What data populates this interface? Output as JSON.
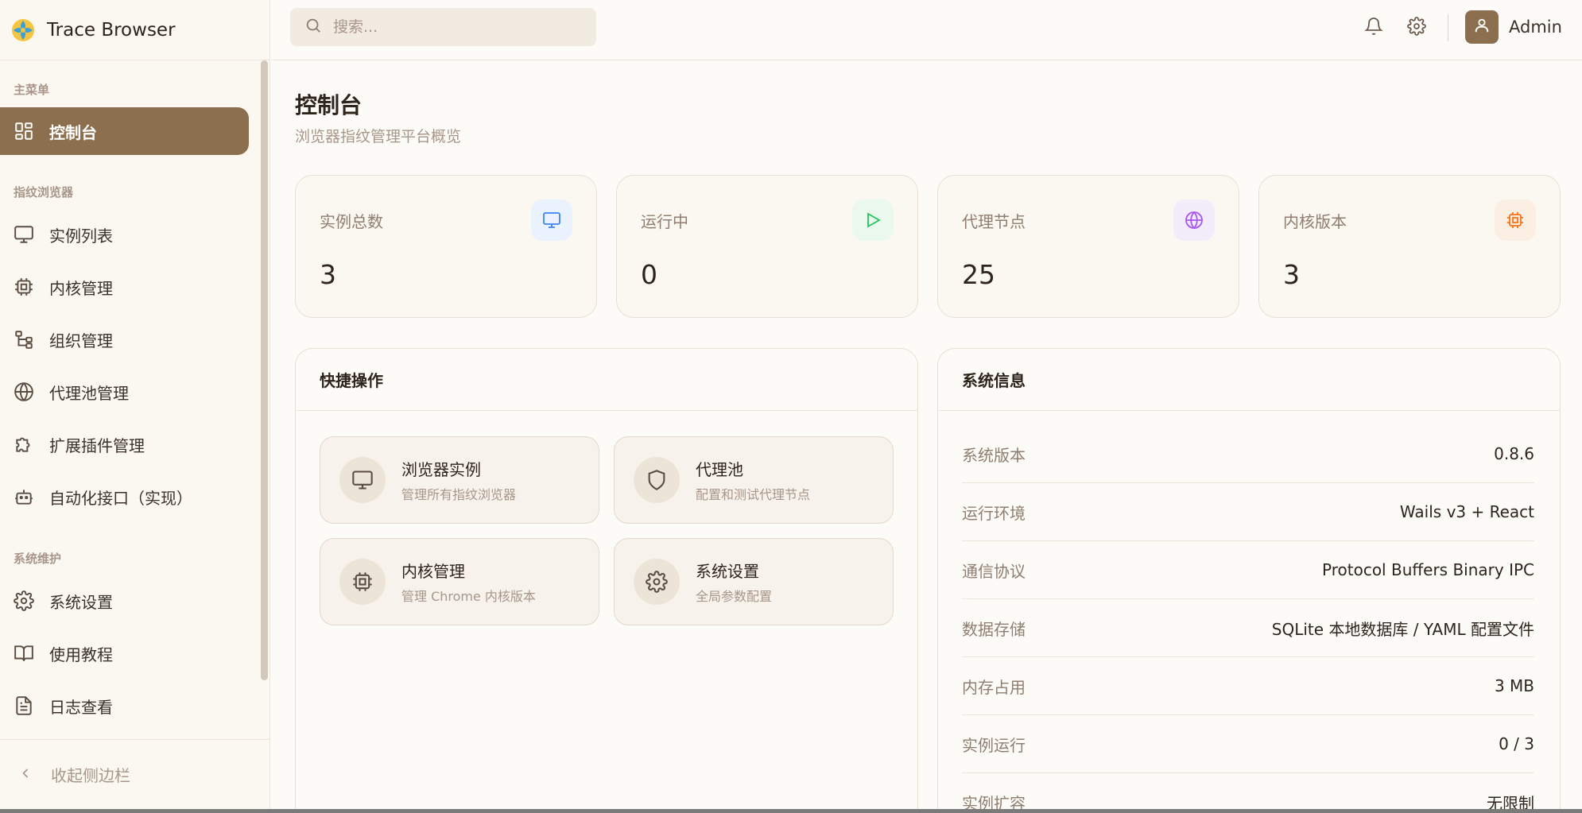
{
  "app": {
    "title": "Trace Browser"
  },
  "search": {
    "placeholder": "搜索..."
  },
  "user": {
    "name": "Admin"
  },
  "sidebar": {
    "sections": [
      {
        "label": "主菜单"
      },
      {
        "label": "指纹浏览器"
      },
      {
        "label": "系统维护"
      }
    ],
    "items": [
      {
        "label": "控制台",
        "icon": "dashboard-icon",
        "active": true
      },
      {
        "label": "实例列表",
        "icon": "monitor-icon"
      },
      {
        "label": "内核管理",
        "icon": "chip-icon"
      },
      {
        "label": "组织管理",
        "icon": "org-tree-icon"
      },
      {
        "label": "代理池管理",
        "icon": "globe-icon"
      },
      {
        "label": "扩展插件管理",
        "icon": "puzzle-icon"
      },
      {
        "label": "自动化接口（实现）",
        "icon": "bot-icon"
      },
      {
        "label": "系统设置",
        "icon": "gear-icon"
      },
      {
        "label": "使用教程",
        "icon": "book-icon"
      },
      {
        "label": "日志查看",
        "icon": "file-text-icon"
      }
    ],
    "collapse_label": "收起侧边栏"
  },
  "page": {
    "title": "控制台",
    "subtitle": "浏览器指纹管理平台概览"
  },
  "stats": [
    {
      "label": "实例总数",
      "value": "3",
      "icon": "monitor-icon",
      "color": "#3b82f6",
      "bg": "#eaf2fd"
    },
    {
      "label": "运行中",
      "value": "0",
      "icon": "play-icon",
      "color": "#22c55e",
      "bg": "#eaf8ee"
    },
    {
      "label": "代理节点",
      "value": "25",
      "icon": "globe-icon",
      "color": "#a855f7",
      "bg": "#f3ecfb"
    },
    {
      "label": "内核版本",
      "value": "3",
      "icon": "chip-icon",
      "color": "#f97316",
      "bg": "#fbefe4"
    }
  ],
  "quick_actions": {
    "title": "快捷操作",
    "items": [
      {
        "title": "浏览器实例",
        "desc": "管理所有指纹浏览器",
        "icon": "monitor-icon"
      },
      {
        "title": "代理池",
        "desc": "配置和测试代理节点",
        "icon": "shield-icon"
      },
      {
        "title": "内核管理",
        "desc": "管理 Chrome 内核版本",
        "icon": "chip-icon"
      },
      {
        "title": "系统设置",
        "desc": "全局参数配置",
        "icon": "gear-icon"
      }
    ]
  },
  "system_info": {
    "title": "系统信息",
    "rows": [
      {
        "key": "系统版本",
        "value": "0.8.6"
      },
      {
        "key": "运行环境",
        "value": "Wails v3 + React"
      },
      {
        "key": "通信协议",
        "value": "Protocol Buffers Binary IPC"
      },
      {
        "key": "数据存储",
        "value": "SQLite 本地数据库 / YAML 配置文件"
      },
      {
        "key": "内存占用",
        "value": "3 MB"
      },
      {
        "key": "实例运行",
        "value": "0 / 3"
      },
      {
        "key": "实例扩容",
        "value": "无限制"
      }
    ]
  },
  "colors": {
    "accent": "#8b6f4e",
    "background": "#fdfbf7",
    "sidebar": "#fbf8f2"
  }
}
